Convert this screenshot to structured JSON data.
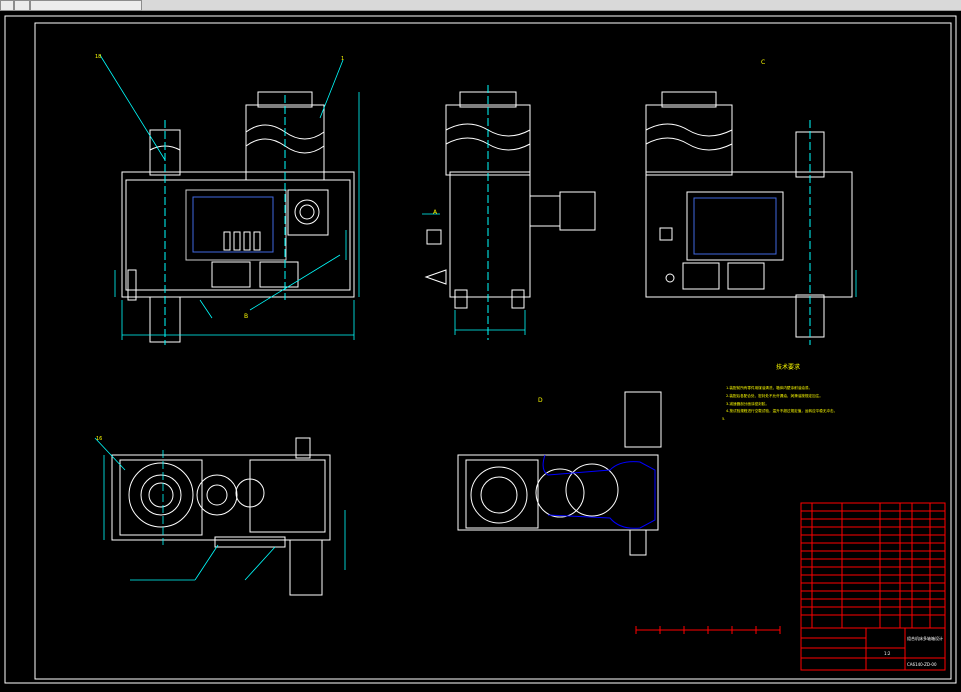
{
  "window": {
    "toolbar_buttons": [
      "",
      "",
      ""
    ]
  },
  "drawing": {
    "view_labels": {
      "section_a": "A",
      "section_b": "B",
      "view_c": "C",
      "view_d": "D"
    },
    "tech_requirements_title": "技术要求",
    "tech_requirements": [
      "1.装配前所有零件用煤油清洗，箱体内壁涂耐油油漆。",
      "2.装配后各配合处、密封处不允许漏油，润滑油按规定加注。",
      "3.减速器剖分面涂密封胶。",
      "4.按试验规程进行空载试验，温升不超过规定值，运转应平稳无冲击。",
      "5."
    ],
    "title_block": {
      "drawing_number": "CA6140-ZD-00",
      "name": "组合机床多轴箱设计",
      "scale": "1:2"
    }
  },
  "colors": {
    "background": "#000000",
    "outline": "#ffffff",
    "dimension": "#00ffff",
    "hidden": "#0000ff",
    "text": "#ffff00",
    "title_block": "#ff0000"
  }
}
